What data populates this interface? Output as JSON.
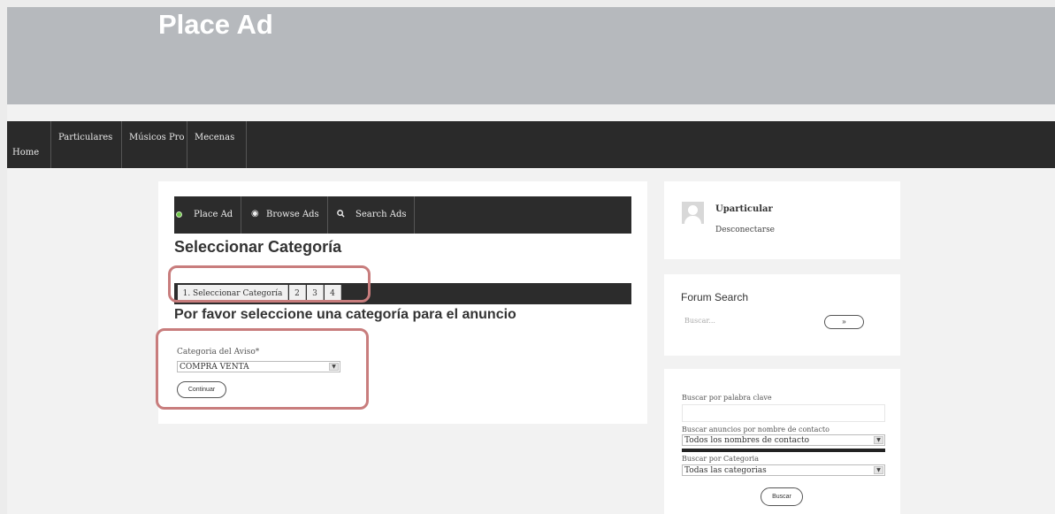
{
  "header": {
    "title": "Place Ad"
  },
  "nav": {
    "home": "Home",
    "items": [
      "Particulares",
      "Músicos Pro",
      "Mecenas"
    ]
  },
  "toolbar": {
    "place_ad": "Place Ad",
    "browse_ads": "Browse Ads",
    "search_ads": "Search Ads"
  },
  "main": {
    "heading": "Seleccionar Categoría",
    "steps": [
      "1. Seleccionar Categoría",
      "2",
      "3",
      "4"
    ],
    "subheading": "Por favor seleccione una categoría para el anuncio",
    "category_label": "Categoria del Aviso*",
    "category_value": "COMPRA VENTA",
    "continue_label": "Continuar"
  },
  "sidebar": {
    "user": {
      "name": "Uparticular",
      "logout": "Desconectarse"
    },
    "forum": {
      "title": "Forum Search",
      "placeholder": "Buscar...",
      "button": "»"
    },
    "ad_search": {
      "keyword_label": "Buscar por palabra clave",
      "contact_label": "Buscar anuncios por nombre de contacto",
      "contact_value": "Todos los nombres de contacto",
      "category_label": "Buscar por Categoria",
      "category_value": "Todas las categorias",
      "button": "Buscar"
    }
  },
  "colors": {
    "header_bg": "#b6b9bd",
    "nav_bg": "#2a2a2a",
    "highlight": "#c87d7d",
    "place_ad_dot": "#6cc644"
  }
}
